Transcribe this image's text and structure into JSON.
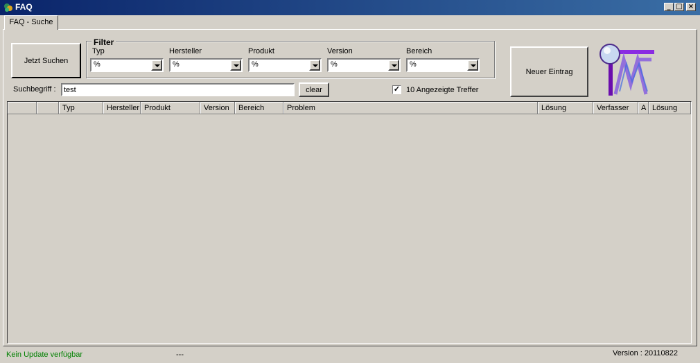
{
  "window": {
    "title": "FAQ",
    "controls": [
      "_",
      "□",
      "×"
    ]
  },
  "tabs": [
    {
      "label": "FAQ - Suche"
    }
  ],
  "search_button": "Jetzt Suchen",
  "filter": {
    "legend": "Filter",
    "fields": [
      {
        "label": "Typ",
        "value": "%"
      },
      {
        "label": "Hersteller",
        "value": "%"
      },
      {
        "label": "Produkt",
        "value": "%"
      },
      {
        "label": "Version",
        "value": "%"
      },
      {
        "label": "Bereich",
        "value": "%"
      }
    ]
  },
  "new_entry_button": "Neuer Eintrag",
  "search": {
    "label": "Suchbegriff :",
    "value": "test",
    "clear_label": "clear"
  },
  "hits": {
    "label": "10 Angezeigte Treffer",
    "checked": true,
    "check_glyph": "✓"
  },
  "grid": {
    "columns": [
      "",
      "",
      "Typ",
      "Hersteller",
      "Produkt",
      "Version",
      "Bereich",
      "Problem",
      "Lösung",
      "Verfasser",
      "A",
      "Lösung"
    ],
    "rows": []
  },
  "status": {
    "left": "Kein Update verfügbar",
    "middle": "---",
    "version": "Version : 20110822"
  },
  "colors": {
    "titlebar": "#0a246a",
    "status_ok": "#008000",
    "logo_purple": "#8a2be2"
  }
}
